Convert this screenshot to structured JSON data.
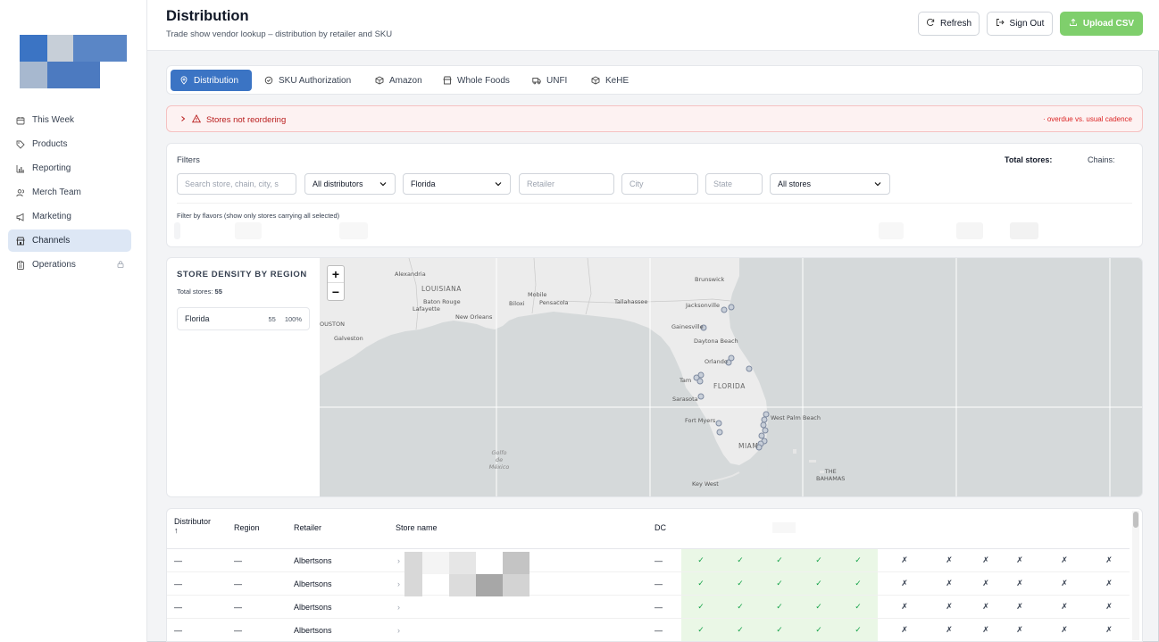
{
  "sidebar": {
    "items": [
      {
        "label": "This Week",
        "icon": "calendar-icon"
      },
      {
        "label": "Products",
        "icon": "tag-icon"
      },
      {
        "label": "Reporting",
        "icon": "bar-chart-icon"
      },
      {
        "label": "Merch Team",
        "icon": "users-icon"
      },
      {
        "label": "Marketing",
        "icon": "megaphone-icon"
      },
      {
        "label": "Channels",
        "icon": "store-icon",
        "active": true
      },
      {
        "label": "Operations",
        "icon": "clipboard-icon",
        "locked": true
      }
    ]
  },
  "header": {
    "title": "Distribution",
    "subtitle": "Trade show vendor lookup – distribution by retailer and SKU",
    "refresh_label": "Refresh",
    "signout_label": "Sign Out",
    "upload_label": "Upload CSV"
  },
  "tabs": [
    {
      "label": "Distribution",
      "icon": "map-pin-icon",
      "active": true
    },
    {
      "label": "SKU Authorization",
      "icon": "check-circle-icon"
    },
    {
      "label": "Amazon",
      "icon": "box-icon"
    },
    {
      "label": "Whole Foods",
      "icon": "store-icon"
    },
    {
      "label": "UNFI",
      "icon": "truck-icon"
    },
    {
      "label": "KeHE",
      "icon": "box-icon"
    }
  ],
  "alert": {
    "title": "Stores not reordering",
    "note": "· overdue vs. usual cadence"
  },
  "filters": {
    "label": "Filters",
    "total_stores_label": "Total stores:",
    "chains_label": "Chains:",
    "search_placeholder": "Search store, chain, city, s",
    "distributor_value": "All distributors",
    "state_select_value": "Florida",
    "retailer_placeholder": "Retailer",
    "city_placeholder": "City",
    "state_placeholder": "State",
    "stores_value": "All stores",
    "flavor_label": "Filter by flavors (show only stores carrying all selected)"
  },
  "density": {
    "title": "STORE DENSITY BY REGION",
    "total_label": "Total stores:",
    "total_value": "55",
    "regions": [
      {
        "name": "Florida",
        "count": "55",
        "pct": "100%"
      }
    ]
  },
  "map": {
    "zoom_in": "+",
    "zoom_out": "−",
    "labels": {
      "alexandria": "Alexandria",
      "louisiana": "LOUISIANA",
      "baton_rouge": "Baton Rouge",
      "lafayette": "Lafayette",
      "new_orleans": "New Orleans",
      "houston": "OUSTON",
      "galveston": "Galveston",
      "mobile": "Mobile",
      "biloxi": "Biloxi",
      "pensacola": "Pensacola",
      "tallahassee": "Tallahassee",
      "brunswick": "Brunswick",
      "jacksonville": "Jacksonville",
      "gainesville": "Gainesville",
      "daytona": "Daytona Beach",
      "orlando": "Orlando",
      "tampa": "Tam",
      "florida": "FLORIDA",
      "sarasota": "Sarasota",
      "fort_myers": "Fort Myers",
      "west_palm": "West Palm Beach",
      "miami": "MIAM",
      "key_west": "Key West",
      "gulf_1": "Golfo",
      "gulf_2": "de",
      "gulf_3": "México",
      "bahamas_1": "THE",
      "bahamas_2": "BAHAMAS"
    }
  },
  "table": {
    "headers": {
      "distributor": "Distributor",
      "sort_arrow": "↑",
      "region": "Region",
      "retailer": "Retailer",
      "store_name": "Store name",
      "dc": "DC"
    },
    "rows": [
      {
        "distributor": "—",
        "region": "—",
        "retailer": "Albertsons",
        "dc": "—"
      },
      {
        "distributor": "—",
        "region": "—",
        "retailer": "Albertsons",
        "dc": "—"
      },
      {
        "distributor": "—",
        "region": "—",
        "retailer": "Albertsons",
        "dc": "—"
      },
      {
        "distributor": "—",
        "region": "—",
        "retailer": "Albertsons",
        "dc": "—"
      }
    ],
    "check_symbol": "✓",
    "cross_symbol": "✗",
    "store_prefix": "›"
  },
  "colors": {
    "accent": "#3b74c4",
    "upload": "#7fcf6c",
    "alert_text": "#b91c1c",
    "check": "#16a34a"
  }
}
